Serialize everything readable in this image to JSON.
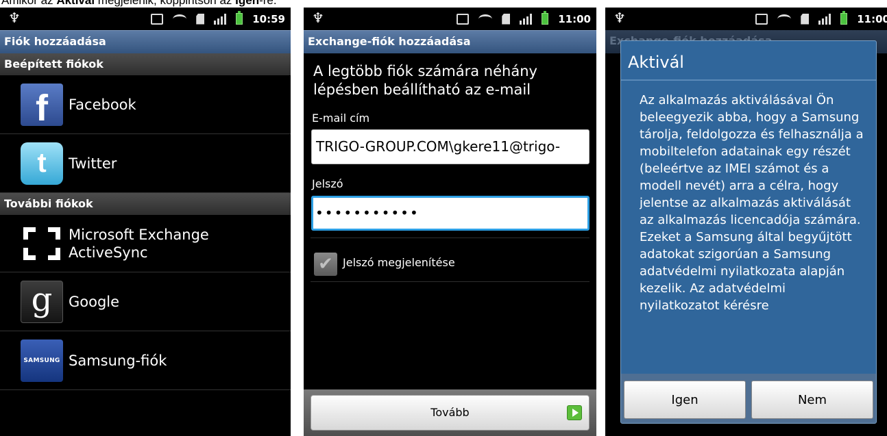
{
  "caption": {
    "lead": "Amikor az",
    "bold1": "Aktivál",
    "mid": "megjelenik, koppintson az",
    "bold2": "Igen",
    "tail": "-re."
  },
  "screens": [
    {
      "status": {
        "time": "10:59"
      },
      "title": "Fiók hozzáadása",
      "sections": [
        {
          "header": "Beépített fiókok",
          "items": [
            {
              "label": "Facebook",
              "icon": "facebook-icon"
            },
            {
              "label": "Twitter",
              "icon": "twitter-icon"
            }
          ]
        },
        {
          "header": "További fiókok",
          "items": [
            {
              "label": "Microsoft Exchange ActiveSync",
              "icon": "exchange-icon"
            },
            {
              "label": "Google",
              "icon": "google-icon"
            },
            {
              "label": "Samsung-fiók",
              "icon": "samsung-icon"
            }
          ]
        }
      ],
      "icon_glyphs": {
        "facebook": "f",
        "twitter": "t",
        "google": "g",
        "samsung": "SAMSUNG"
      }
    },
    {
      "status": {
        "time": "11:00"
      },
      "title": "Exchange-fiók hozzáadása",
      "intro": "A legtöbb fiók számára néhány lépésben beállítható az e-mail",
      "email_label": "E-mail cím",
      "email_value": "TRIGO-GROUP.COM\\gkere11@trigo-",
      "password_label": "Jelszó",
      "password_value": "•••••••••••",
      "show_password_label": "Jelszó megjelenítése",
      "next_label": "Tovább"
    },
    {
      "status": {
        "time": "11:00"
      },
      "bg_title": "Exchange-fiók hozzáadása",
      "dialog": {
        "title": "Aktivál",
        "body": "Az alkalmazás aktiválásával Ön beleegyezik abba, hogy a Samsung tárolja, feldolgozza és felhasználja a mobiltelefon adatainak egy részét (beleértve az IMEI számot és a modell nevét) arra a célra, hogy jelentse az alkalmazás aktiválását az alkalmazás licencadója számára. Ezeket a Samsung által begyűjtött adatokat szigorúan a Samsung adatvédelmi nyilatkozata alapján kezelik. Az adatvédelmi nyilatkozatot kérésre",
        "yes_label": "Igen",
        "no_label": "Nem"
      }
    }
  ],
  "colors": {
    "title_bar": "#34547e",
    "dialog_bg": "#30669b",
    "battery": "#4cc23f",
    "focus_border": "#2d9fe4"
  }
}
